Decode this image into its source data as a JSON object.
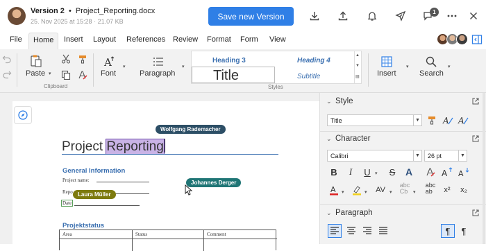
{
  "header": {
    "version": "Version 2",
    "bullet": "•",
    "filename": "Project_Reporting.docx",
    "meta": "25. Nov 2025 at 15:28 · 21.07 KB",
    "save_label": "Save new Version",
    "notification_count": "1"
  },
  "menu": [
    "File",
    "Home",
    "Insert",
    "Layout",
    "References",
    "Review",
    "Format",
    "Form",
    "View"
  ],
  "ribbon": {
    "paste_label": "Paste",
    "clipboard_label": "Clipboard",
    "font_label": "Font",
    "paragraph_label": "Paragraph",
    "heading3": "Heading 3",
    "heading4": "Heading 4",
    "title_style": "Title",
    "subtitle_style": "Subtitle",
    "styles_label": "Styles",
    "insert_label": "Insert",
    "search_label": "Search"
  },
  "document": {
    "title_part1": "Project ",
    "title_part2": "Reporting",
    "section1": "General Information",
    "field1": "Project name:",
    "field2": "Repo",
    "field3": "Date",
    "section2": "Projektstatus",
    "table_headers": [
      "Area",
      "Status",
      "Comment"
    ]
  },
  "collaborators": [
    {
      "name": "Wolfgang Rademacher",
      "color": "#2d4f66"
    },
    {
      "name": "Johannes Derger",
      "color": "#1f7575"
    },
    {
      "name": "Laura Müller",
      "color": "#7d7a0e"
    }
  ],
  "panel": {
    "style_heading": "Style",
    "style_value": "Title",
    "character_heading": "Character",
    "font_value": "Calibri",
    "size_value": "26 pt",
    "paragraph_heading": "Paragraph"
  },
  "colors": {
    "accent": "#2f7fe6",
    "heading_blue": "#3a6fb0",
    "highlight": "#c9b3e6"
  }
}
